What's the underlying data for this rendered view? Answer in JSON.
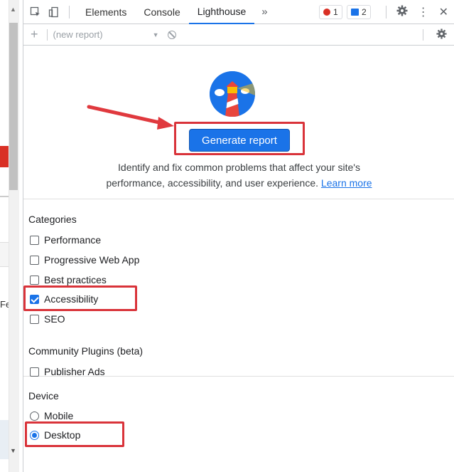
{
  "toolbar": {
    "tabs": [
      "Elements",
      "Console",
      "Lighthouse"
    ],
    "active_tab": "Lighthouse",
    "more": "»",
    "error_count": "1",
    "message_count": "2",
    "close": "✕",
    "menu": "⋮"
  },
  "subbar": {
    "add": "+",
    "report_select": "(new report)"
  },
  "hero": {
    "generate_button": "Generate report",
    "description_line1": "Identify and fix common problems that affect your site's",
    "description_line2": "performance, accessibility, and user experience.",
    "learn_more": "Learn more"
  },
  "categories": {
    "heading": "Categories",
    "items": [
      {
        "label": "Performance",
        "checked": false
      },
      {
        "label": "Progressive Web App",
        "checked": false
      },
      {
        "label": "Best practices",
        "checked": false
      },
      {
        "label": "Accessibility",
        "checked": true
      },
      {
        "label": "SEO",
        "checked": false
      }
    ]
  },
  "plugins": {
    "heading": "Community Plugins (beta)",
    "items": [
      {
        "label": "Publisher Ads",
        "checked": false
      }
    ]
  },
  "device": {
    "heading": "Device",
    "options": [
      {
        "label": "Mobile",
        "selected": false
      },
      {
        "label": "Desktop",
        "selected": true
      }
    ]
  },
  "page_fragment": {
    "cut_text": "Fe"
  },
  "colors": {
    "accent": "#1a73e8",
    "highlight": "#d9333a",
    "error": "#d93025"
  }
}
